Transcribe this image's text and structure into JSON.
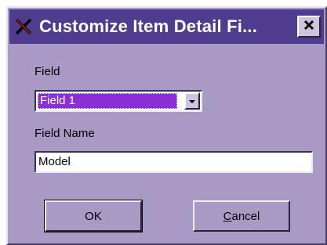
{
  "window": {
    "title": "Customize Item Detail Fi...",
    "app_icon": "x-mark-icon",
    "close_icon": "close-icon"
  },
  "form": {
    "field_label": "Field",
    "field_value": "Field 1",
    "field_name_label": "Field Name",
    "field_name_value": "Model"
  },
  "buttons": {
    "ok_label": "OK",
    "cancel_label": "Cancel"
  },
  "colors": {
    "titlebar": "#4f3c8f",
    "dialog_bg": "#a89ac4",
    "selection": "#8a2fd6"
  }
}
